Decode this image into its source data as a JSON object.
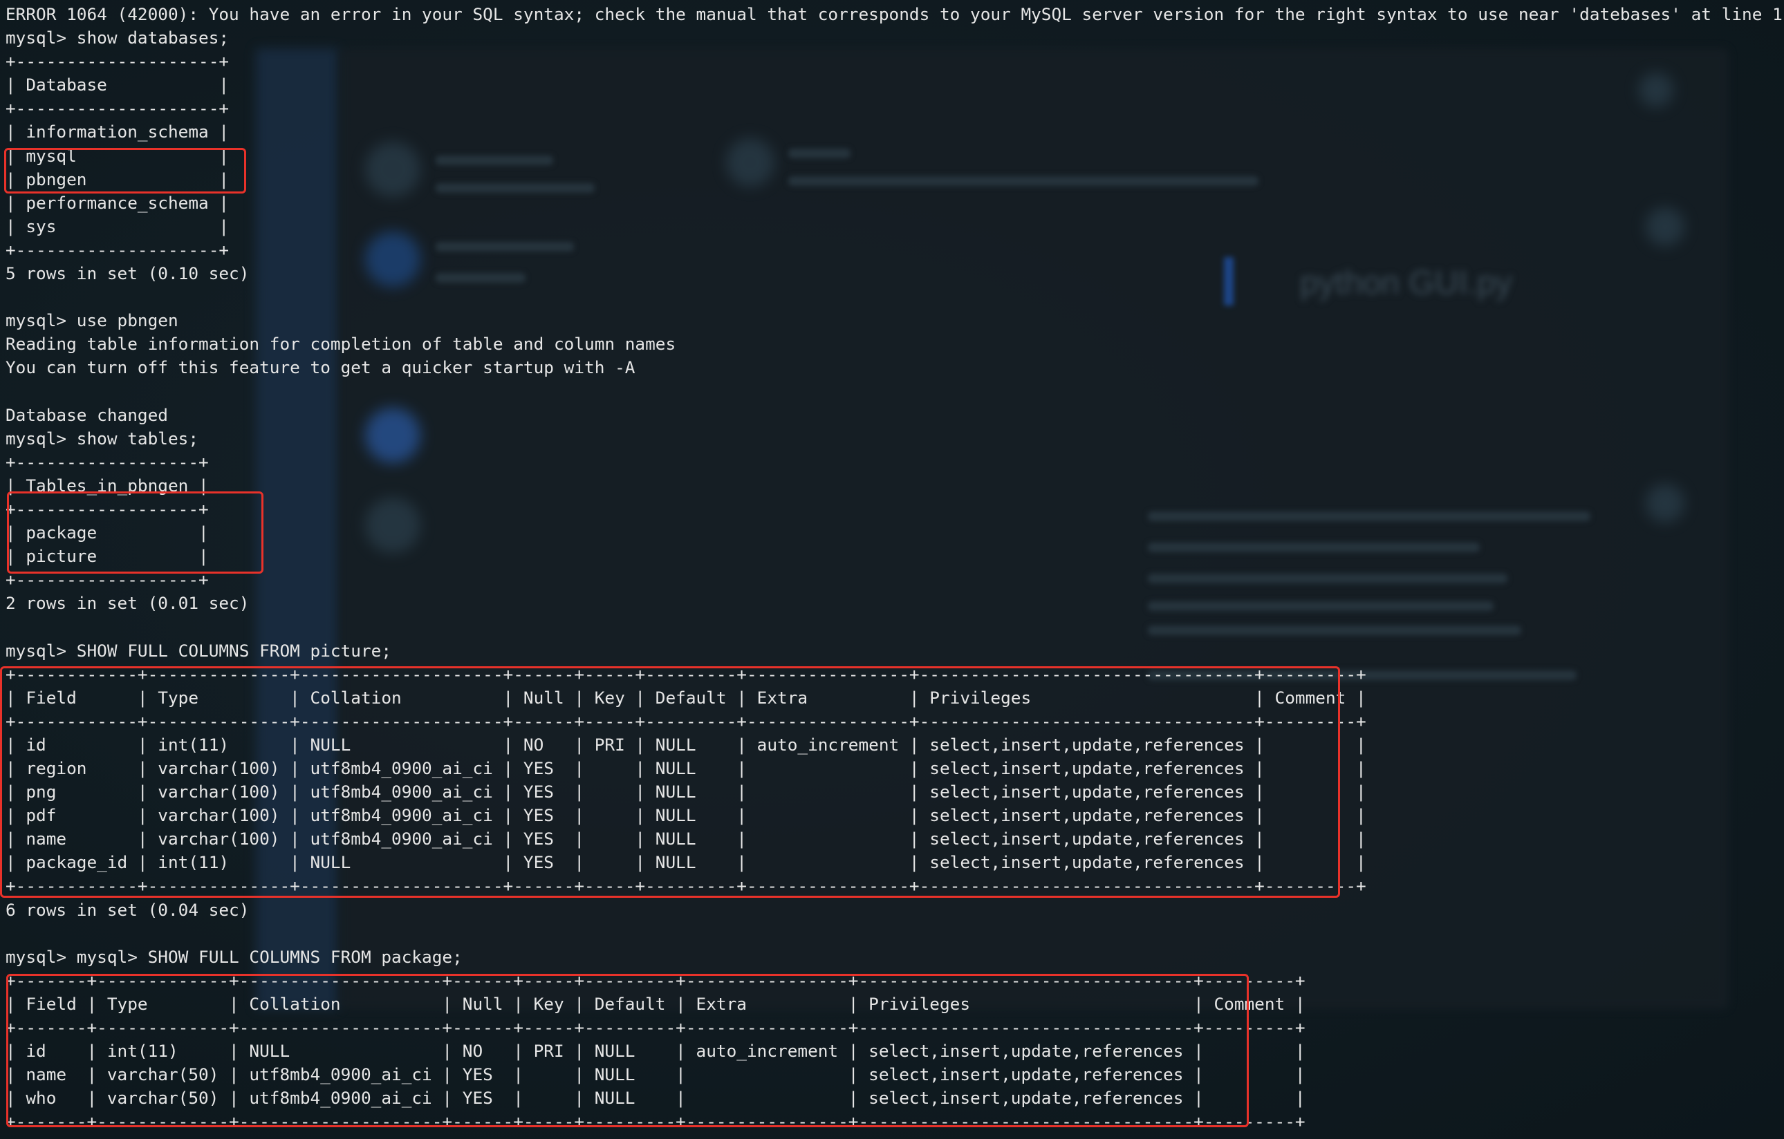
{
  "terminal": {
    "lines": [
      "ERROR 1064 (42000): You have an error in your SQL syntax; check the manual that corresponds to your MySQL server version for the right syntax to use near 'datebases' at line 1",
      "mysql> show databases;",
      "+--------------------+",
      "| Database           |",
      "+--------------------+",
      "| information_schema |",
      "| mysql              |",
      "| pbngen             |",
      "| performance_schema |",
      "| sys                |",
      "+--------------------+",
      "5 rows in set (0.10 sec)",
      "",
      "mysql> use pbngen",
      "Reading table information for completion of table and column names",
      "You can turn off this feature to get a quicker startup with -A",
      "",
      "Database changed",
      "mysql> show tables;",
      "+------------------+",
      "| Tables_in_pbngen |",
      "+------------------+",
      "| package          |",
      "| picture          |",
      "+------------------+",
      "2 rows in set (0.01 sec)",
      "",
      "mysql> SHOW FULL COLUMNS FROM picture;",
      "+------------+--------------+--------------------+------+-----+---------+----------------+---------------------------------+---------+",
      "| Field      | Type         | Collation          | Null | Key | Default | Extra          | Privileges                      | Comment |",
      "+------------+--------------+--------------------+------+-----+---------+----------------+---------------------------------+---------+",
      "| id         | int(11)      | NULL               | NO   | PRI | NULL    | auto_increment | select,insert,update,references |         |",
      "| region     | varchar(100) | utf8mb4_0900_ai_ci | YES  |     | NULL    |                | select,insert,update,references |         |",
      "| png        | varchar(100) | utf8mb4_0900_ai_ci | YES  |     | NULL    |                | select,insert,update,references |         |",
      "| pdf        | varchar(100) | utf8mb4_0900_ai_ci | YES  |     | NULL    |                | select,insert,update,references |         |",
      "| name       | varchar(100) | utf8mb4_0900_ai_ci | YES  |     | NULL    |                | select,insert,update,references |         |",
      "| package_id | int(11)      | NULL               | YES  |     | NULL    |                | select,insert,update,references |         |",
      "+------------+--------------+--------------------+------+-----+---------+----------------+---------------------------------+---------+",
      "6 rows in set (0.04 sec)",
      "",
      "mysql> mysql> SHOW FULL COLUMNS FROM package;",
      "+-------+-------------+--------------------+------+-----+---------+----------------+---------------------------------+---------+",
      "| Field | Type        | Collation          | Null | Key | Default | Extra          | Privileges                      | Comment |",
      "+-------+-------------+--------------------+------+-----+---------+----------------+---------------------------------+---------+",
      "| id    | int(11)     | NULL               | NO   | PRI | NULL    | auto_increment | select,insert,update,references |         |",
      "| name  | varchar(50) | utf8mb4_0900_ai_ci | YES  |     | NULL    |                | select,insert,update,references |         |",
      "| who   | varchar(50) | utf8mb4_0900_ai_ci | YES  |     | NULL    |                | select,insert,update,references |         |",
      "+-------+-------------+--------------------+------+-----+---------+----------------+---------------------------------+---------+"
    ]
  },
  "background": {
    "blurred_text": "python GUI.py"
  },
  "colors": {
    "terminal_text": "#e6e6e6",
    "highlight_border": "#e8322a",
    "background": "#0f1a20"
  }
}
